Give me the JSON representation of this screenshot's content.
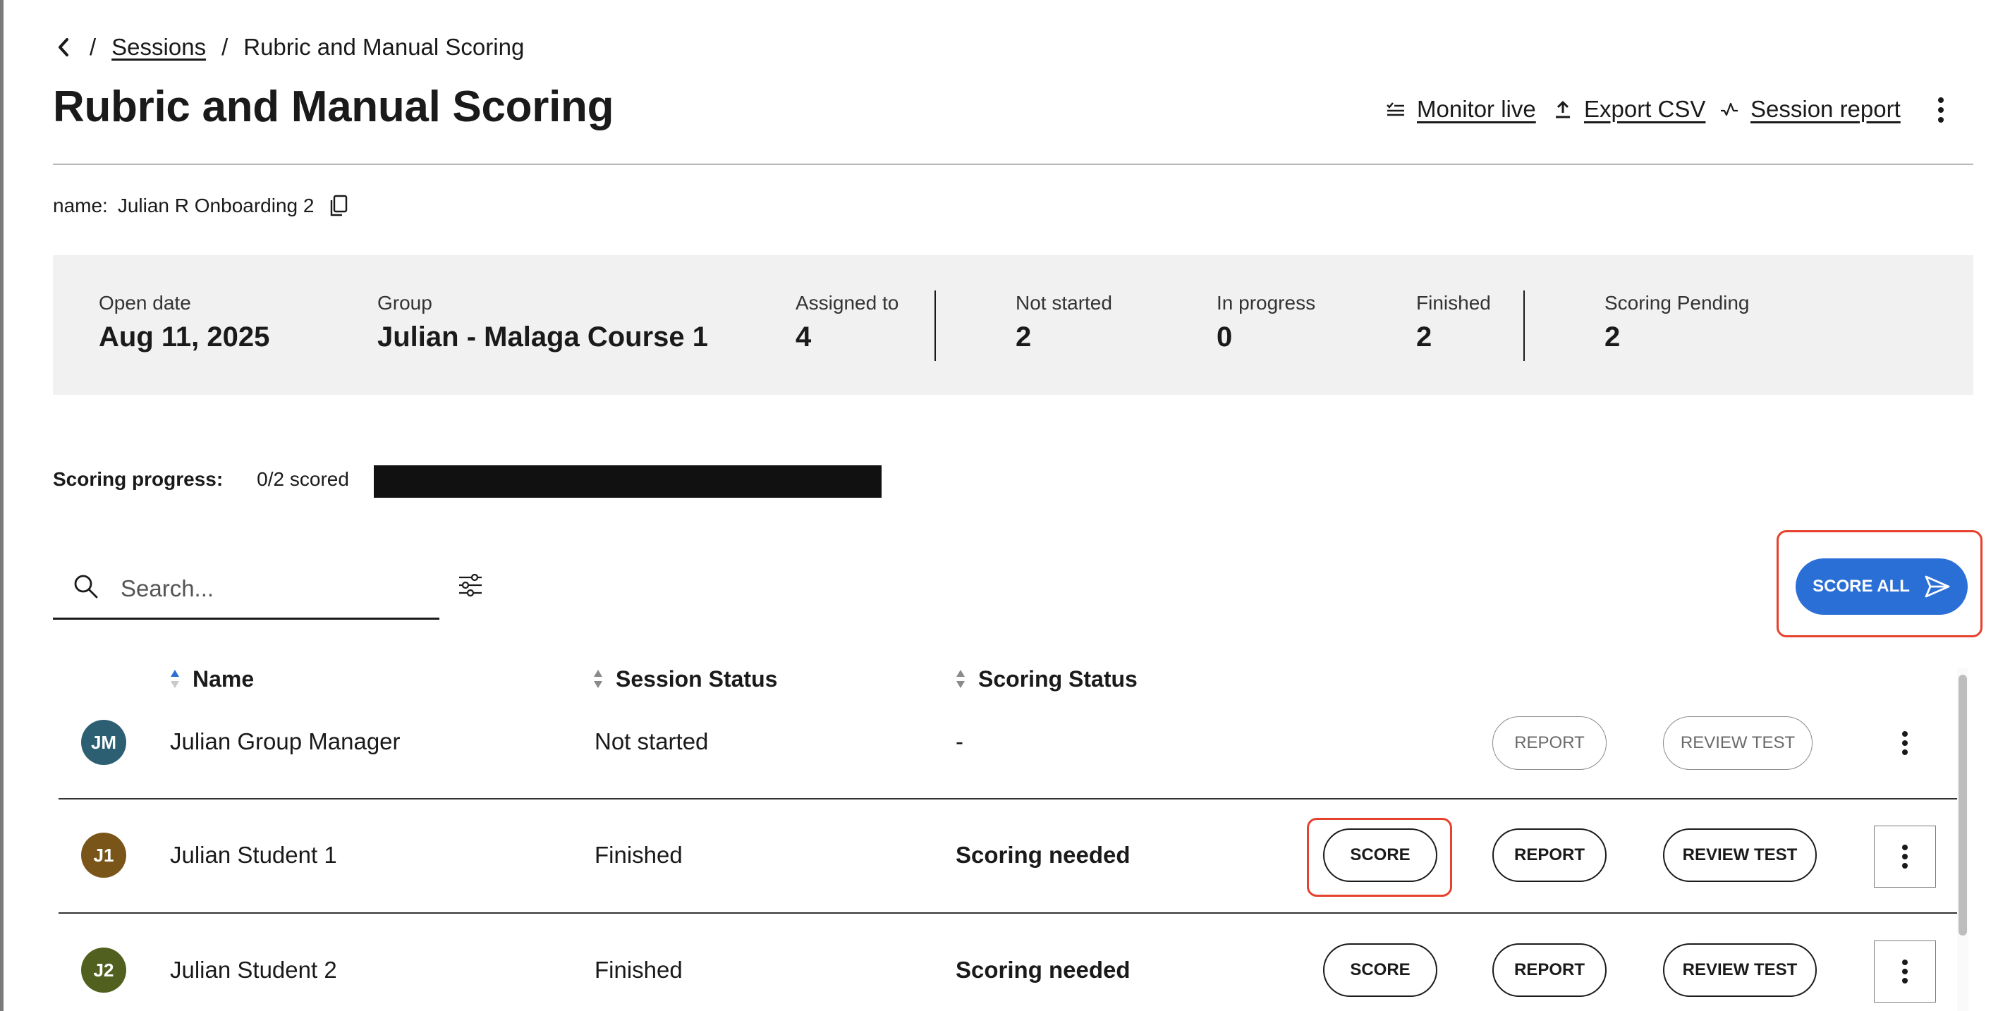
{
  "breadcrumb": {
    "parent": "Sessions",
    "separator": "/",
    "current": "Rubric and Manual Scoring"
  },
  "page": {
    "title": "Rubric and Manual Scoring"
  },
  "header_actions": {
    "monitor_live": "Monitor live",
    "export_csv": "Export CSV",
    "session_report": "Session report"
  },
  "session": {
    "name_label": "name:",
    "name_value": "Julian R Onboarding 2"
  },
  "stats": [
    {
      "label": "Open date",
      "value": "Aug 11, 2025"
    },
    {
      "label": "Group",
      "value": "Julian - Malaga Course 1"
    },
    {
      "label": "Assigned to",
      "value": "4"
    },
    {
      "label": "Not started",
      "value": "2"
    },
    {
      "label": "In progress",
      "value": "0"
    },
    {
      "label": "Finished",
      "value": "2"
    },
    {
      "label": "Scoring Pending",
      "value": "2"
    }
  ],
  "scoring_progress": {
    "label": "Scoring progress:",
    "text": "0/2 scored",
    "fraction": 0
  },
  "search": {
    "placeholder": "Search..."
  },
  "score_all": {
    "label": "SCORE ALL"
  },
  "table": {
    "columns": [
      {
        "label": "Name",
        "sort": "ascending"
      },
      {
        "label": "Session Status",
        "sort": "none"
      },
      {
        "label": "Scoring Status",
        "sort": "none"
      }
    ],
    "rows": [
      {
        "initials": "JM",
        "avatar_color": "#2d5f73",
        "name": "Julian Group Manager",
        "session_status": "Not started",
        "scoring_status": "-",
        "score_label": "",
        "report_label": "REPORT",
        "review_label": "REVIEW TEST",
        "enabled": false
      },
      {
        "initials": "J1",
        "avatar_color": "#7a5519",
        "name": "Julian Student 1",
        "session_status": "Finished",
        "scoring_status": "Scoring needed",
        "score_label": "SCORE",
        "report_label": "REPORT",
        "review_label": "REVIEW TEST",
        "enabled": true
      },
      {
        "initials": "J2",
        "avatar_color": "#52601f",
        "name": "Julian Student 2",
        "session_status": "Finished",
        "scoring_status": "Scoring needed",
        "score_label": "SCORE",
        "report_label": "REPORT",
        "review_label": "REVIEW TEST",
        "enabled": true
      }
    ]
  },
  "colors": {
    "accent": "#2a6fd6",
    "highlight": "#e5412d",
    "stats_bg": "#f1f1f1"
  }
}
